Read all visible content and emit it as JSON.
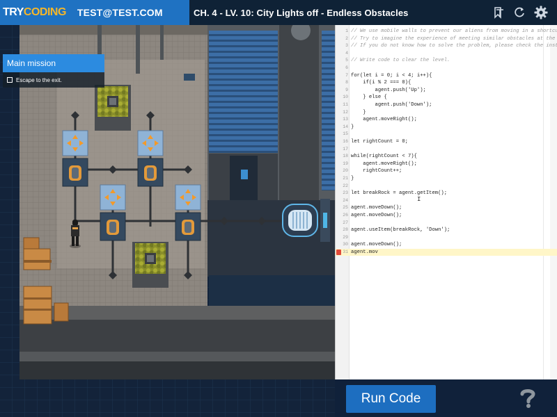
{
  "header": {
    "logo_try": "TRY",
    "logo_coding": "CODING",
    "user_email": "TEST@TEST.COM",
    "level_title": "CH. 4 - LV. 10: City Lights off - Endless Obstacles",
    "icons": [
      "bookmark-icon",
      "restart-icon",
      "gear-icon"
    ]
  },
  "mission": {
    "title": "Main mission",
    "items": [
      {
        "text": "Escape to the exit.",
        "checked": false
      }
    ]
  },
  "editor": {
    "lines": [
      {
        "n": "1",
        "text": "// We use mobile walls to prevent our aliens from moving in a shortcut.",
        "type": "comment"
      },
      {
        "n": "2",
        "text": "// Try to imagine the experience of meeting similar obstacles at the airport in the pa",
        "type": "comment"
      },
      {
        "n": "3",
        "text": "// If you do not know how to solve the problem, please check the instructions.",
        "type": "comment"
      },
      {
        "n": "4",
        "text": "",
        "type": "code"
      },
      {
        "n": "5",
        "text": "// Write code to clear the level.",
        "type": "comment"
      },
      {
        "n": "6",
        "text": "",
        "type": "code"
      },
      {
        "n": "7",
        "text": "for(let i = 0; i < 4; i++){",
        "type": "code"
      },
      {
        "n": "8",
        "text": "    if(i % 2 === 0){",
        "type": "code"
      },
      {
        "n": "9",
        "text": "        agent.push('Up');",
        "type": "code"
      },
      {
        "n": "10",
        "text": "    } else {",
        "type": "code"
      },
      {
        "n": "11",
        "text": "        agent.push('Down');",
        "type": "code"
      },
      {
        "n": "12",
        "text": "    }",
        "type": "code"
      },
      {
        "n": "13",
        "text": "    agent.moveRight();",
        "type": "code"
      },
      {
        "n": "14",
        "text": "}",
        "type": "code"
      },
      {
        "n": "15",
        "text": "",
        "type": "code"
      },
      {
        "n": "16",
        "text": "let rightCount = 0;",
        "type": "code"
      },
      {
        "n": "17",
        "text": "",
        "type": "code"
      },
      {
        "n": "18",
        "text": "while(rightCount < 7){",
        "type": "code"
      },
      {
        "n": "19",
        "text": "    agent.moveRight();",
        "type": "code"
      },
      {
        "n": "20",
        "text": "    rightCount++;",
        "type": "code"
      },
      {
        "n": "21",
        "text": "}",
        "type": "code"
      },
      {
        "n": "22",
        "text": "",
        "type": "code"
      },
      {
        "n": "23",
        "text": "let breakRock = agent.getItem();",
        "type": "code"
      },
      {
        "n": "24",
        "text": "",
        "type": "code"
      },
      {
        "n": "25",
        "text": "agent.moveDown();",
        "type": "code"
      },
      {
        "n": "26",
        "text": "agent.moveDown();",
        "type": "code"
      },
      {
        "n": "27",
        "text": "",
        "type": "code"
      },
      {
        "n": "28",
        "text": "agent.useItem(breakRock, 'Down');",
        "type": "code"
      },
      {
        "n": "29",
        "text": "",
        "type": "code"
      },
      {
        "n": "30",
        "text": "agent.moveDown();",
        "type": "code"
      },
      {
        "n": "31",
        "text": "agent.mov",
        "type": "code",
        "active": true,
        "error": true
      }
    ]
  },
  "footer": {
    "run_label": "Run Code",
    "help_icon": "question-circle-icon"
  },
  "colors": {
    "brand_blue": "#1f72c2",
    "logo_accent": "#f6b72a",
    "header_dark": "#0f2236",
    "run_button": "#1d6ec0",
    "error_marker": "#e04a3a"
  }
}
